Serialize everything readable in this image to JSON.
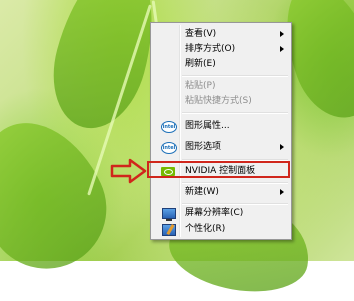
{
  "context_menu": {
    "items": [
      {
        "label": "查看(V)",
        "submenu": true,
        "disabled": false
      },
      {
        "label": "排序方式(O)",
        "submenu": true,
        "disabled": false
      },
      {
        "label": "刷新(E)",
        "submenu": false,
        "disabled": false
      },
      {
        "label": "粘贴(P)",
        "submenu": false,
        "disabled": true
      },
      {
        "label": "粘贴快捷方式(S)",
        "submenu": false,
        "disabled": true
      },
      {
        "label": "图形属性...",
        "submenu": false,
        "disabled": false,
        "icon": "intel-graphics-icon"
      },
      {
        "label": "图形选项",
        "submenu": true,
        "disabled": false,
        "icon": "intel-graphics-icon"
      },
      {
        "label": "NVIDIA 控制面板",
        "submenu": false,
        "disabled": false,
        "icon": "nvidia-icon",
        "highlighted": true
      },
      {
        "label": "新建(W)",
        "submenu": true,
        "disabled": false
      },
      {
        "label": "屏幕分辨率(C)",
        "submenu": false,
        "disabled": false,
        "icon": "display-icon"
      },
      {
        "label": "个性化(R)",
        "submenu": false,
        "disabled": false,
        "icon": "personalize-icon"
      }
    ]
  },
  "intel_icon_text": "intel",
  "colors": {
    "highlight_border": "#d0261c",
    "arrow": "#d0261c",
    "nvidia_green": "#76b900",
    "menu_background": "#f0f0f0"
  }
}
